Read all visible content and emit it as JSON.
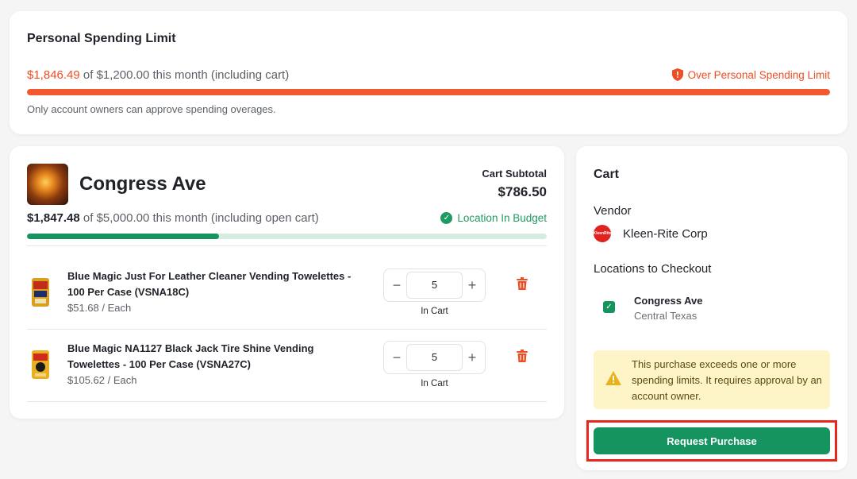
{
  "personal_limit": {
    "title": "Personal Spending Limit",
    "spent": "$1,846.49",
    "limit_text": "of $1,200.00 this month (including cart)",
    "status": "Over Personal Spending Limit",
    "progress": 1.0,
    "note": "Only account owners can approve spending overages.",
    "accent_color": "#f04d23"
  },
  "location": {
    "name": "Congress Ave",
    "cart_subtotal_label": "Cart Subtotal",
    "cart_subtotal": "$786.50",
    "spent": "$1,847.48",
    "limit_text": "of $5,000.00 this month (including open cart)",
    "status": "Location In Budget",
    "progress": 0.369,
    "items": [
      {
        "title": "Blue Magic Just For Leather Cleaner Vending Towelettes - 100 Per Case (VSNA18C)",
        "price": "$51.68 / Each",
        "quantity": "5",
        "status": "In Cart"
      },
      {
        "title": "Blue Magic NA1127 Black Jack Tire Shine Vending Towelettes - 100 Per Case (VSNA27C)",
        "price": "$105.62 / Each",
        "quantity": "5",
        "status": "In Cart"
      }
    ]
  },
  "cart": {
    "title": "Cart",
    "vendor_label": "Vendor",
    "vendor_name": "Kleen-Rite Corp",
    "vendor_logo_text": "KleenRite",
    "locations_label": "Locations to Checkout",
    "checkout_location": {
      "name": "Congress Ave",
      "region": "Central Texas",
      "checked": true
    },
    "warning": "This purchase exceeds one or more spending limits. It requires approval by an account owner.",
    "request_button": "Request Purchase",
    "brand_color": "#159460"
  }
}
